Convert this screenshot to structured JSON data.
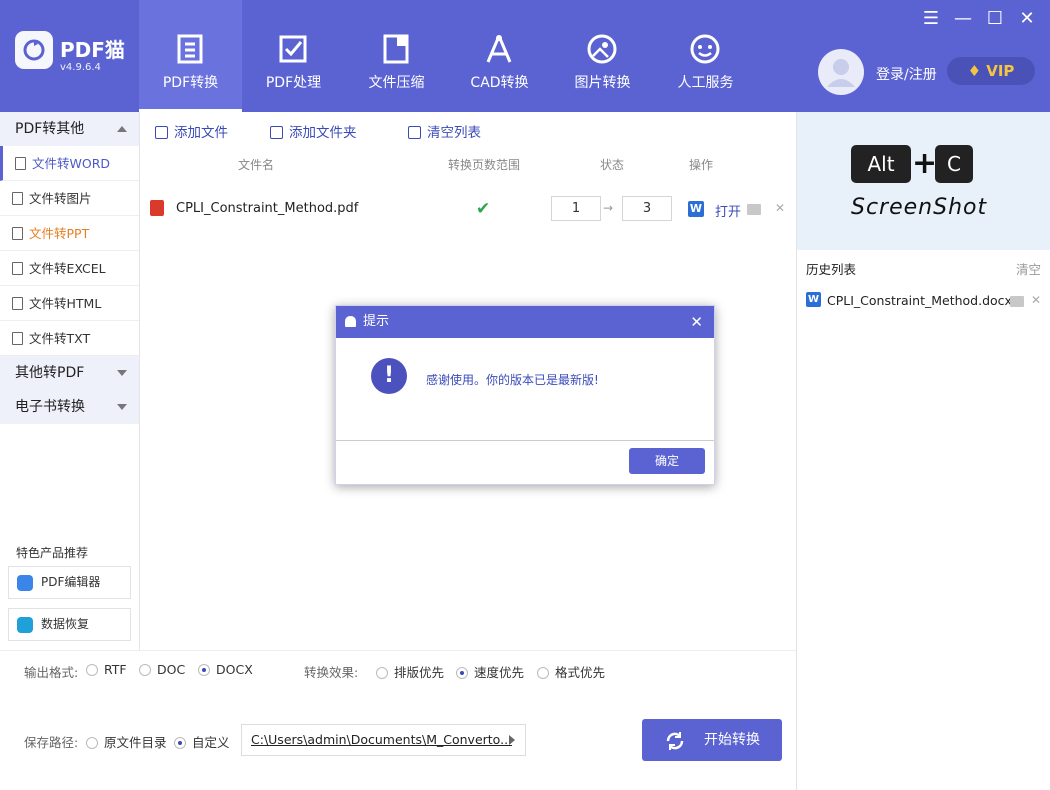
{
  "app": {
    "title": "PDF猫",
    "version": "v4.9.6.4"
  },
  "nav": [
    {
      "label": "PDF转换",
      "icon": "pdf-convert-icon"
    },
    {
      "label": "PDF处理",
      "icon": "pdf-process-icon"
    },
    {
      "label": "文件压缩",
      "icon": "compress-icon"
    },
    {
      "label": "CAD转换",
      "icon": "cad-icon"
    },
    {
      "label": "图片转换",
      "icon": "image-convert-icon"
    },
    {
      "label": "人工服务",
      "icon": "service-icon"
    }
  ],
  "window": {
    "menu": "☰",
    "minimize": "—",
    "maximize": "☐",
    "close": "✕"
  },
  "user": {
    "login": "登录/注册",
    "vip": "VIP"
  },
  "sidebar": {
    "section_pdf_to_other": "PDF转其他",
    "items": [
      {
        "label": "文件转WORD"
      },
      {
        "label": "文件转图片"
      },
      {
        "label": "文件转PPT"
      },
      {
        "label": "文件转EXCEL"
      },
      {
        "label": "文件转HTML"
      },
      {
        "label": "文件转TXT"
      }
    ],
    "section_other_to_pdf": "其他转PDF",
    "section_ebook": "电子书转换",
    "featured_title": "特色产品推荐",
    "featured": [
      {
        "label": "PDF编辑器"
      },
      {
        "label": "数据恢复"
      }
    ]
  },
  "toolbar": {
    "add_file": "添加文件",
    "add_folder": "添加文件夹",
    "clear_list": "清空列表"
  },
  "table": {
    "headers": {
      "filename": "文件名",
      "page_range": "转换页数范围",
      "status": "状态",
      "action": "操作"
    },
    "rows": [
      {
        "filename": "CPLI_Constraint_Method.pdf",
        "page_from": "1",
        "page_to": "3",
        "open": "打开"
      }
    ]
  },
  "screenshot_promo": {
    "key1": "Alt",
    "plus": "+",
    "key2": "C",
    "caption": "ScreenShot"
  },
  "history": {
    "title": "历史列表",
    "clear": "清空",
    "items": [
      {
        "filename": "CPLI_Constraint_Method.docx"
      }
    ]
  },
  "output": {
    "format_label": "输出格式:",
    "formats": [
      "RTF",
      "DOC",
      "DOCX"
    ],
    "selected_format": "DOCX",
    "effect_label": "转换效果:",
    "effects": [
      "排版优先",
      "速度优先",
      "格式优先"
    ],
    "selected_effect": "速度优先"
  },
  "save": {
    "label": "保存路径:",
    "options": [
      "原文件目录",
      "自定义"
    ],
    "selected": "自定义",
    "path": "C:\\Users\\admin\\Documents\\M_Converto..."
  },
  "start_button": "开始转换",
  "dialog": {
    "title": "提示",
    "message": "感谢使用。你的版本已是最新版!",
    "ok": "确定",
    "close": "✕",
    "icon_glyph": "!"
  },
  "colors": {
    "primary": "#5b63d3",
    "accent_orange": "#e67e22",
    "success": "#2aa84a"
  }
}
